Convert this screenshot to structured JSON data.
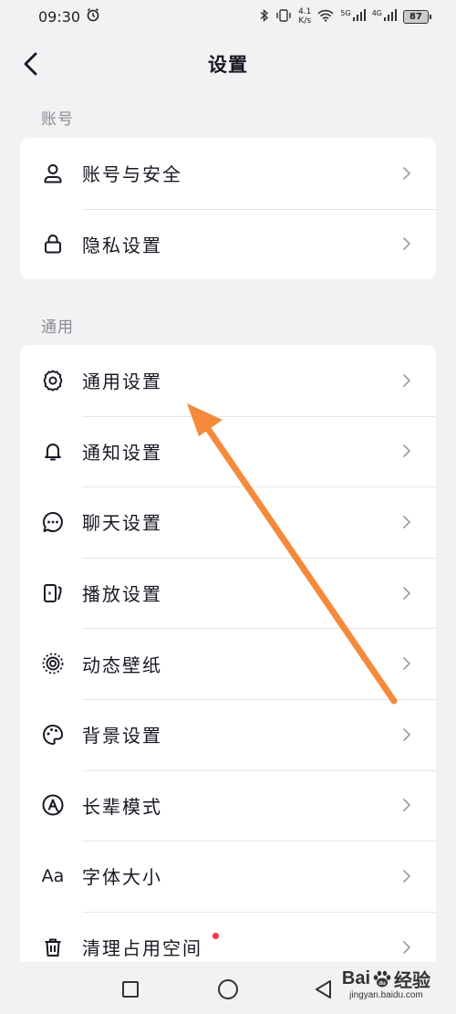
{
  "status_bar": {
    "time": "09:30",
    "net_speed_value": "4.1",
    "net_speed_unit": "K/s",
    "signal_1_label": "5G",
    "signal_2_label": "4G",
    "battery": "87"
  },
  "nav": {
    "title": "设置"
  },
  "sections": [
    {
      "header": "账号",
      "items": [
        {
          "label": "账号与安全",
          "icon": "person-icon"
        },
        {
          "label": "隐私设置",
          "icon": "lock-icon"
        }
      ]
    },
    {
      "header": "通用",
      "items": [
        {
          "label": "通用设置",
          "icon": "gear-icon"
        },
        {
          "label": "通知设置",
          "icon": "bell-icon"
        },
        {
          "label": "聊天设置",
          "icon": "chat-icon"
        },
        {
          "label": "播放设置",
          "icon": "play-device-icon"
        },
        {
          "label": "动态壁纸",
          "icon": "wallpaper-icon"
        },
        {
          "label": "背景设置",
          "icon": "palette-icon"
        },
        {
          "label": "长辈模式",
          "icon": "elder-mode-icon"
        },
        {
          "label": "字体大小",
          "icon": "font-size-icon",
          "icon_text": "Aa"
        },
        {
          "label": "清理占用空间",
          "icon": "trash-icon",
          "badge": "red-dot"
        }
      ]
    }
  ],
  "watermark": {
    "main": "Bai",
    "main_suffix": "经验",
    "sub": "jingyan.baidu.com"
  },
  "colors": {
    "background": "#f2f2f4",
    "card": "#ffffff",
    "text": "#161823",
    "section_header": "#8a8b91",
    "annotation_arrow": "#f58a3c",
    "badge": "#fe2c55"
  }
}
